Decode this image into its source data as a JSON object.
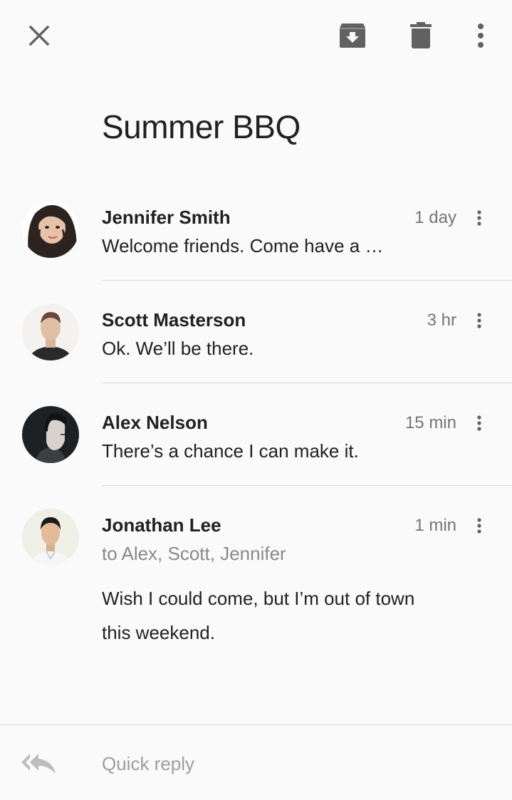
{
  "toolbar": {
    "close_icon": "close-icon",
    "archive_icon": "archive-icon",
    "delete_icon": "delete-icon",
    "more_icon": "more-vert-icon"
  },
  "subject": "Summer BBQ",
  "messages": [
    {
      "sender": "Jennifer Smith",
      "time": "1 day",
      "snippet": "Welcome friends. Come have a …",
      "avatar": "avatar-jennifer"
    },
    {
      "sender": "Scott Masterson",
      "time": "3 hr",
      "snippet": "Ok. We’ll be there.",
      "avatar": "avatar-scott"
    },
    {
      "sender": "Alex Nelson",
      "time": "15 min",
      "snippet": "There’s a chance I can make it.",
      "avatar": "avatar-alex"
    },
    {
      "sender": "Jonathan Lee",
      "time": "1 min",
      "recipients": "to Alex, Scott, Jennifer",
      "body": "Wish I could come, but I’m out of town this weekend.",
      "avatar": "avatar-jonathan"
    }
  ],
  "reply": {
    "placeholder": "Quick reply",
    "icon": "reply-all-icon"
  },
  "colors": {
    "background": "#fafafa",
    "icon_gray": "#616161",
    "secondary_text": "#757575",
    "divider": "#dcdcdc"
  }
}
